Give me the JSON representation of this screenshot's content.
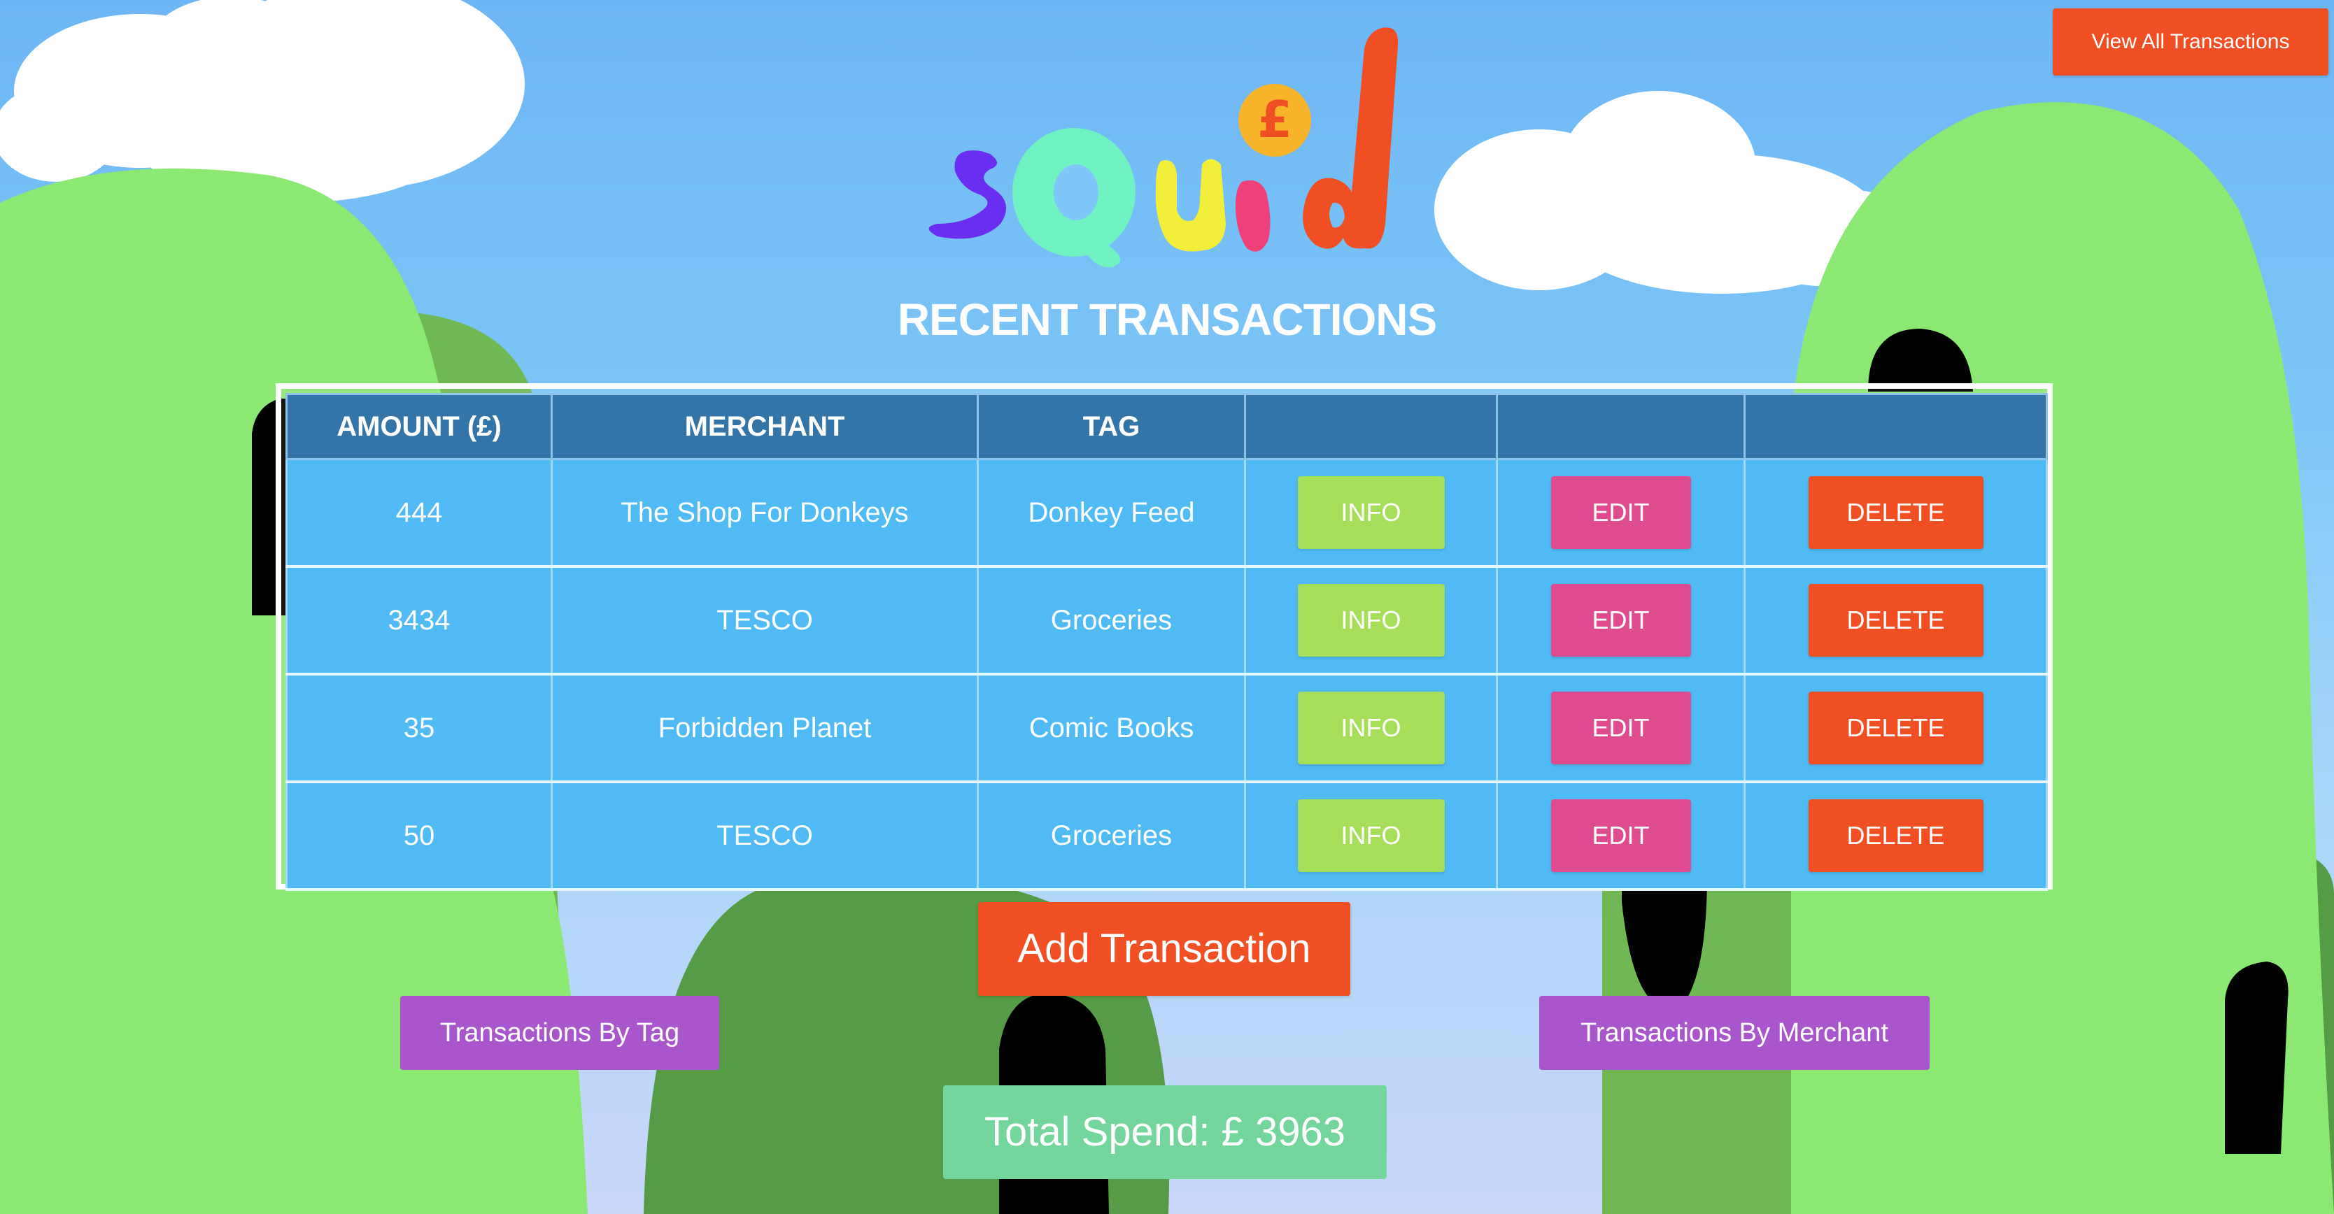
{
  "header": {
    "view_all_label": "View All Transactions",
    "logo_text": "sQuid",
    "logo_coin_symbol": "£"
  },
  "page": {
    "title": "RECENT TRANSACTIONS"
  },
  "table": {
    "columns": [
      "AMOUNT (£)",
      "MERCHANT",
      "TAG",
      "",
      "",
      ""
    ],
    "rows": [
      {
        "amount": "444",
        "merchant": "The Shop For Donkeys",
        "tag": "Donkey Feed"
      },
      {
        "amount": "3434",
        "merchant": "TESCO",
        "tag": "Groceries"
      },
      {
        "amount": "35",
        "merchant": "Forbidden Planet",
        "tag": "Comic Books"
      },
      {
        "amount": "50",
        "merchant": "TESCO",
        "tag": "Groceries"
      }
    ],
    "info_label": "INFO",
    "edit_label": "EDIT",
    "delete_label": "DELETE"
  },
  "actions": {
    "add_label": "Add Transaction",
    "by_tag_label": "Transactions By Tag",
    "by_merchant_label": "Transactions By Merchant"
  },
  "summary": {
    "total_label": "Total Spend: £",
    "total_value": "3963"
  },
  "colors": {
    "sky": "#6db6f5",
    "accent_orange": "#f04e23",
    "info_green": "#a6de5a",
    "edit_pink": "#de4b8f",
    "purple": "#a956cd",
    "total_green": "#74d69c",
    "table_header": "#3375a9",
    "table_cell": "#4fbaf3",
    "hill_light": "#8be872",
    "hill_dark": "#569b45",
    "logo_s": "#6a2ef0",
    "logo_q": "#6ff2c2",
    "logo_u": "#f2ee3a",
    "logo_i": "#f0407a",
    "logo_d": "#f04e23",
    "logo_coin": "#f8b42a"
  }
}
